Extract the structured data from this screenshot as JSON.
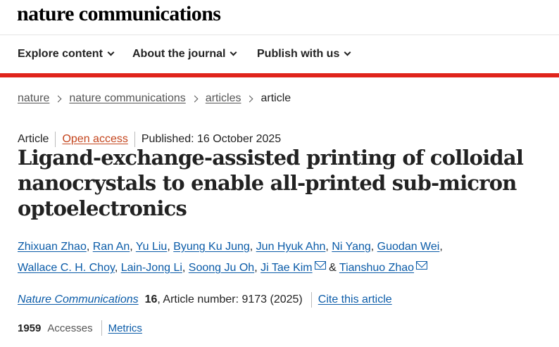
{
  "brand": "nature communications",
  "nav": [
    {
      "label": "Explore content"
    },
    {
      "label": "About the journal"
    },
    {
      "label": "Publish with us"
    }
  ],
  "breadcrumb": [
    "nature",
    "nature communications",
    "articles",
    "article"
  ],
  "article": {
    "type": "Article",
    "access": "Open access",
    "published": "Published: 16 October 2025",
    "title": "Ligand-exchange-assisted printing of colloidal nanocrystals to enable all-printed sub-micron optoelectronics",
    "authors": [
      "Zhixuan Zhao",
      "Ran An",
      "Yu Liu",
      "Byung Ku Jung",
      "Jun Hyuk Ahn",
      "Ni Yang",
      "Guodan Wei",
      "Wallace C. H. Choy",
      "Lain-Jong Li",
      "Soong Ju Oh",
      "Ji Tae Kim",
      "Tianshuo Zhao"
    ],
    "author_separator": ",",
    "author_and": "&",
    "journal": "Nature Communications",
    "volume": "16",
    "article_number": ", Article number: 9173 (2025)",
    "cite_label": "Cite this article",
    "accesses_count": "1959",
    "accesses_label": "Accesses",
    "metrics_label": "Metrics"
  },
  "colors": {
    "accent_red": "#e0241b",
    "link_blue": "#0a5ba8",
    "open_access": "#c4441c"
  }
}
